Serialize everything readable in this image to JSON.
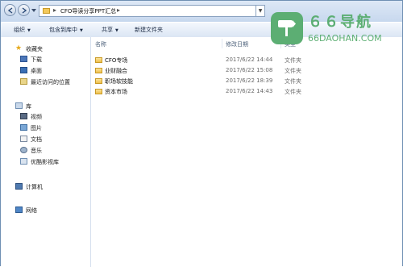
{
  "address": {
    "path": "CFO导读分享PPT汇总",
    "separator": "▸"
  },
  "toolbar": {
    "organize": "组织",
    "include_in_library": "包含到库中",
    "share": "共享",
    "new_folder": "新建文件夹"
  },
  "nav": {
    "favorites": "收藏夹",
    "downloads": "下载",
    "desktop": "桌面",
    "recent": "最近访问的位置",
    "libraries": "库",
    "videos": "视频",
    "pictures": "图片",
    "documents": "文档",
    "music": "音乐",
    "youku": "优酷影视库",
    "computer": "计算机",
    "network": "网络"
  },
  "columns": {
    "name": "名称",
    "date": "修改日期",
    "type": "类型"
  },
  "files": [
    {
      "name": "CFO专场",
      "date": "2017/6/22 14:44",
      "type": "文件夹"
    },
    {
      "name": "业财融合",
      "date": "2017/6/22 15:08",
      "type": "文件夹"
    },
    {
      "name": "职场软技能",
      "date": "2017/6/22 18:39",
      "type": "文件夹"
    },
    {
      "name": "资本市场",
      "date": "2017/6/22 14:43",
      "type": "文件夹"
    }
  ],
  "watermark": {
    "title": "６６导航",
    "subtitle": "66DAOHAN.COM"
  },
  "colors": {
    "accent_green": "#5cae73",
    "folder_yellow": "#eec04b",
    "window_border": "#6f8fb3"
  }
}
